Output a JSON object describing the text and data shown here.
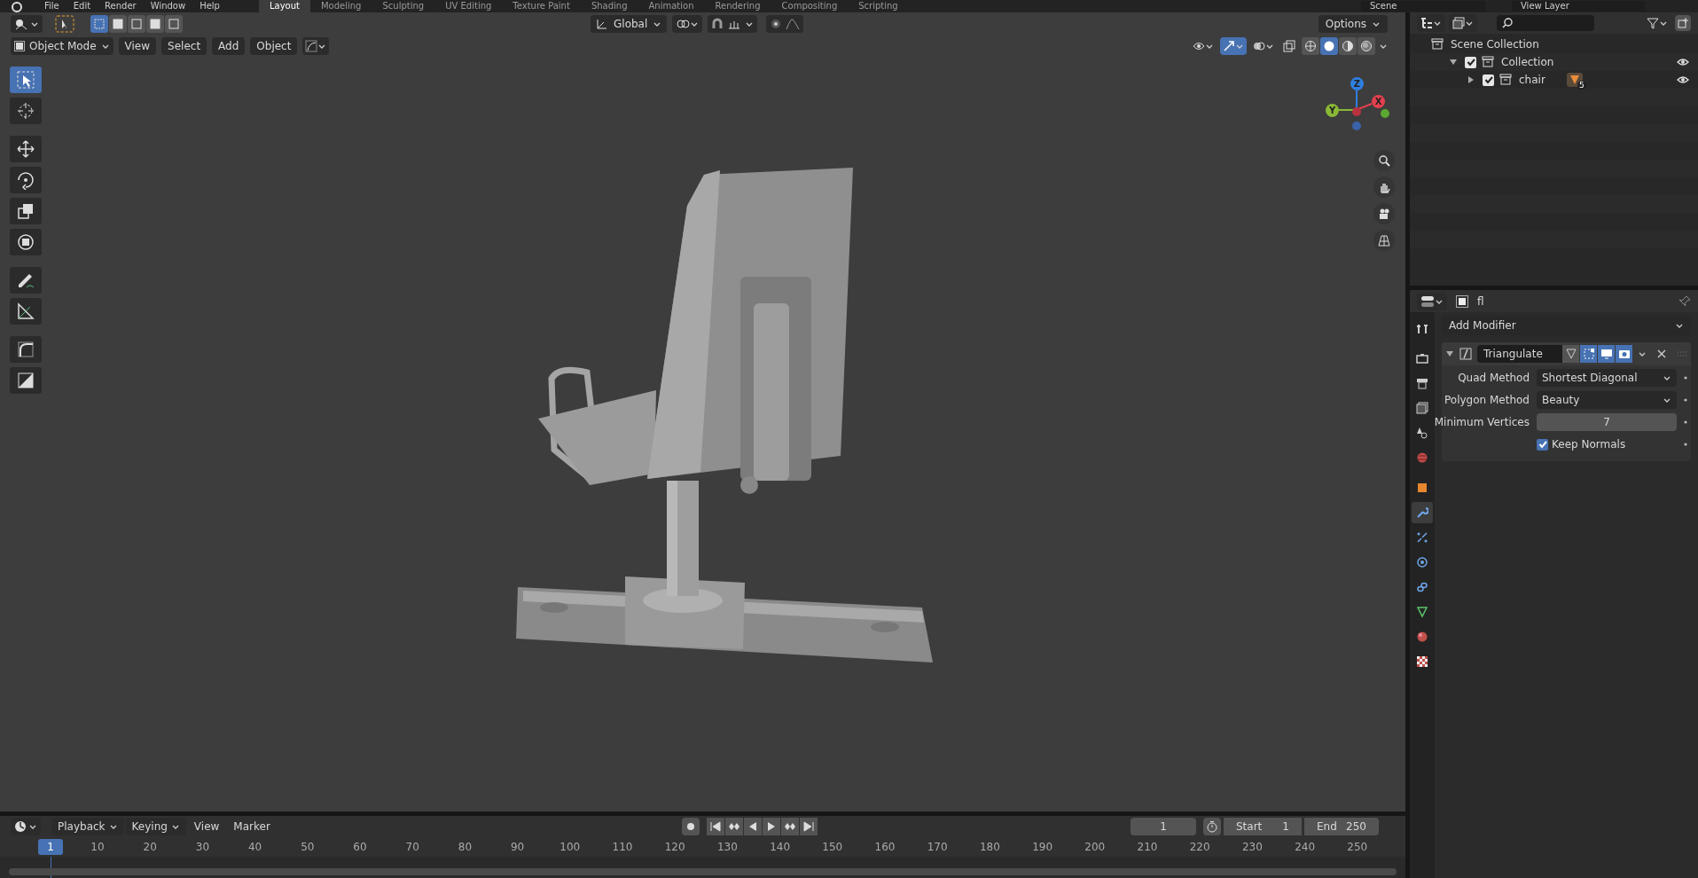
{
  "top_bar": {
    "menus": [
      "File",
      "Edit",
      "Render",
      "Window",
      "Help"
    ],
    "workspaces": [
      {
        "label": "Layout",
        "selected": true
      },
      {
        "label": "Modeling",
        "selected": false
      },
      {
        "label": "Sculpting",
        "selected": false
      },
      {
        "label": "UV Editing",
        "selected": false
      },
      {
        "label": "Texture Paint",
        "selected": false
      },
      {
        "label": "Shading",
        "selected": false
      },
      {
        "label": "Animation",
        "selected": false
      },
      {
        "label": "Rendering",
        "selected": false
      },
      {
        "label": "Compositing",
        "selected": false
      },
      {
        "label": "Scripting",
        "selected": false
      }
    ],
    "scene": "Scene",
    "view_layer": "View Layer"
  },
  "viewport": {
    "select_modes": [
      {
        "selected": true
      },
      {
        "selected": false
      },
      {
        "selected": false
      },
      {
        "selected": false
      },
      {
        "selected": false
      }
    ],
    "transform_orientation": "Global",
    "options": "Options",
    "mode": "Object Mode",
    "menus": [
      "View",
      "Select",
      "Add",
      "Object"
    ],
    "shading": [
      {
        "selected": false
      },
      {
        "selected": true
      },
      {
        "selected": false
      },
      {
        "selected": false
      }
    ],
    "tools": [
      {
        "kind": "select",
        "selected": true
      },
      {
        "kind": "cursor",
        "selected": false
      },
      {
        "kind": "move",
        "selected": false
      },
      {
        "kind": "rotate",
        "selected": false
      },
      {
        "kind": "scale",
        "selected": false
      },
      {
        "kind": "transform",
        "selected": false
      },
      {
        "kind": "annotate",
        "selected": false
      },
      {
        "kind": "measure",
        "selected": false
      },
      {
        "kind": "curve",
        "selected": false
      },
      {
        "kind": "square",
        "selected": false
      }
    ],
    "gizmo_axes": [
      {
        "label": "Z",
        "color": "#2f7fe0"
      },
      {
        "label": "Y",
        "color": "#8ab936"
      },
      {
        "label": "X",
        "color": "#e2404f"
      }
    ]
  },
  "outliner": {
    "tree": [
      {
        "label": "Scene Collection",
        "children": [
          {
            "label": "Collection",
            "checked": true,
            "visible": true,
            "expanded": true,
            "children": [
              {
                "label": "chair",
                "checked": true,
                "visible": true,
                "expanded": false,
                "modifier_count": "5"
              }
            ]
          }
        ]
      }
    ]
  },
  "properties": {
    "object_name": "fl",
    "add_modifier": "Add Modifier",
    "tabs": [
      {
        "kind": "tool",
        "selected": false
      },
      {
        "kind": "render",
        "selected": false
      },
      {
        "kind": "output",
        "selected": false
      },
      {
        "kind": "view-layer",
        "selected": false
      },
      {
        "kind": "scene",
        "selected": false
      },
      {
        "kind": "world",
        "selected": false
      },
      {
        "kind": "object",
        "selected": false
      },
      {
        "kind": "modifier",
        "selected": true
      },
      {
        "kind": "particles",
        "selected": false
      },
      {
        "kind": "physics",
        "selected": false
      },
      {
        "kind": "constraints",
        "selected": false
      },
      {
        "kind": "data",
        "selected": false
      },
      {
        "kind": "material",
        "selected": false
      },
      {
        "kind": "texture",
        "selected": false
      }
    ],
    "modifier": {
      "name": "Triangulate",
      "expanded": true,
      "fields": [
        {
          "kind": "dropdown",
          "label": "Quad Method",
          "value": "Shortest Diagonal"
        },
        {
          "kind": "dropdown",
          "label": "Polygon Method",
          "value": "Beauty"
        },
        {
          "kind": "number",
          "label": "Minimum Vertices",
          "value": "7"
        },
        {
          "kind": "checkbox",
          "label": "Keep Normals",
          "checked": true
        }
      ]
    }
  },
  "timeline": {
    "menus": [
      "Playback",
      "Keying",
      "View",
      "Marker"
    ],
    "current_frame": "1",
    "start_label": "Start",
    "start": "1",
    "end_label": "End",
    "end": "250",
    "ruler": [
      {
        "label": "1",
        "selected": true
      },
      {
        "label": "10",
        "selected": false
      },
      {
        "label": "20",
        "selected": false
      },
      {
        "label": "30",
        "selected": false
      },
      {
        "label": "40",
        "selected": false
      },
      {
        "label": "50",
        "selected": false
      },
      {
        "label": "60",
        "selected": false
      },
      {
        "label": "70",
        "selected": false
      },
      {
        "label": "80",
        "selected": false
      },
      {
        "label": "90",
        "selected": false
      },
      {
        "label": "100",
        "selected": false
      },
      {
        "label": "110",
        "selected": false
      },
      {
        "label": "120",
        "selected": false
      },
      {
        "label": "130",
        "selected": false
      },
      {
        "label": "140",
        "selected": false
      },
      {
        "label": "150",
        "selected": false
      },
      {
        "label": "160",
        "selected": false
      },
      {
        "label": "170",
        "selected": false
      },
      {
        "label": "180",
        "selected": false
      },
      {
        "label": "190",
        "selected": false
      },
      {
        "label": "200",
        "selected": false
      },
      {
        "label": "210",
        "selected": false
      },
      {
        "label": "220",
        "selected": false
      },
      {
        "label": "230",
        "selected": false
      },
      {
        "label": "240",
        "selected": false
      },
      {
        "label": "250",
        "selected": false
      }
    ]
  }
}
